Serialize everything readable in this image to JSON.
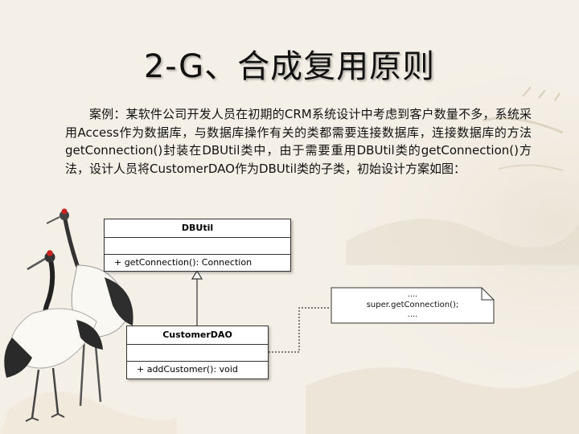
{
  "slide": {
    "title": "2-G、合成复用原则",
    "paragraph": "案例：某软件公司开发人员在初期的CRM系统设计中考虑到客户数量不多，系统采用Access作为数据库，与数据库操作有关的类都需要连接数据库，连接数据库的方法getConnection()封装在DBUtil类中，由于需要重用DBUtil类的getConnection()方法，设计人员将CustomerDAO作为DBUtil类的子类，初始设计方案如图："
  },
  "diagram": {
    "dbutil": {
      "name": "DBUtil",
      "operation": "+ getConnection(): Connection"
    },
    "customerdao": {
      "name": "CustomerDAO",
      "operation": "+ addCustomer(): void"
    },
    "note": {
      "line1": "....",
      "line2": "super.getConnection();",
      "line3": "...."
    }
  },
  "decoration": {
    "crane_icon": "crane-illustration"
  }
}
